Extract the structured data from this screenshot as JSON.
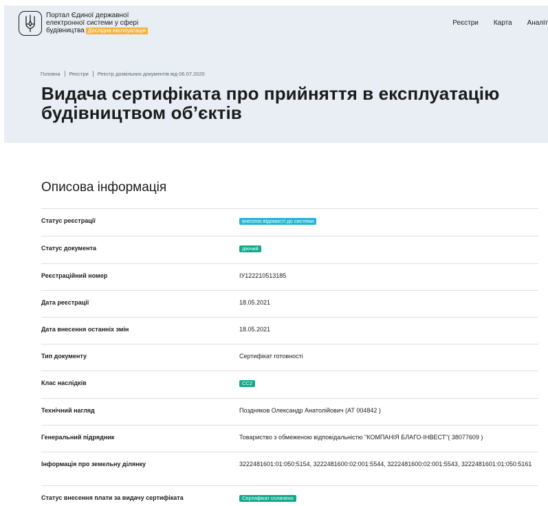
{
  "header": {
    "portal_line1": "Портал Єдиної державної",
    "portal_line2": "електронної системи у сфері",
    "portal_line3": "будівництва",
    "test_badge": "Дослідна експлуатація",
    "logo_icon": "trident-icon",
    "nav": [
      "Реєстри",
      "Карта",
      "Аналіт"
    ]
  },
  "breadcrumbs": [
    "Головна",
    "Реєстри",
    "Реєстр дозвільних документів від 06.07.2020"
  ],
  "page": {
    "title_line1": "Видача сертифіката про прийняття в експлуатацію",
    "title_line2": "будівництвом об’єктів",
    "section_title": "Описова інформація"
  },
  "colors": {
    "hero_bg": "#e8eef3",
    "badge_blue": "#1fb6d8",
    "badge_green": "#12a98c",
    "test_badge": "#f2b33d"
  },
  "details": [
    {
      "label": "Статус реєстрації",
      "value": "внесено відомості до системи",
      "kind": "pill",
      "color": "blue"
    },
    {
      "label": "Статус документа",
      "value": "діючий",
      "kind": "pill",
      "color": "green"
    },
    {
      "label": "Реєстраційний номер",
      "value": "ІУ122210513185",
      "kind": "text"
    },
    {
      "label": "Дата реєстрації",
      "value": "18.05.2021",
      "kind": "text"
    },
    {
      "label": "Дата внесення останніх змін",
      "value": "18.05.2021",
      "kind": "text"
    },
    {
      "label": "Тип документу",
      "value": "Сертифікат готовності",
      "kind": "text"
    },
    {
      "label": "Клас наслідків",
      "value": "СС2",
      "kind": "pill",
      "color": "green"
    },
    {
      "label": "Технічний нагляд",
      "value": "Поздняков Олександр Анатолійович (АТ 004842 )",
      "kind": "text"
    },
    {
      "label": "Генеральний підрядник",
      "value": "Товариство з обмеженою відповідальністю \"КОМПАНІЯ БЛАГО-ІНВЕСТ\"( 38077609 )",
      "kind": "text"
    },
    {
      "label": "Інформація про земельну ділянку",
      "value": "3222481601:01:050:5154, 3222481600:02:001:5544, 3222481600:02:001:5543, 3222481601:01:050:5161",
      "kind": "text"
    },
    {
      "label": "Статус внесення плати за видачу сертифіката",
      "value": "Сертифікат сплачено",
      "kind": "pill",
      "color": "green"
    }
  ]
}
